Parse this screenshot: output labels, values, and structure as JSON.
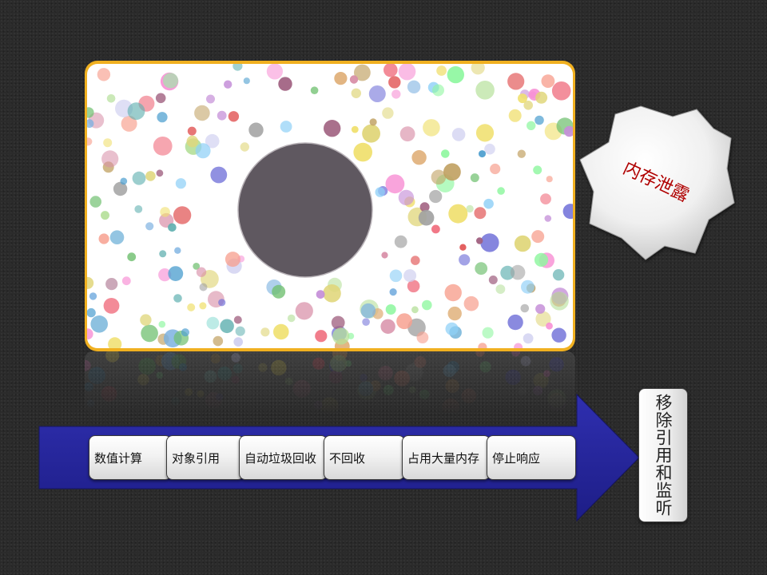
{
  "slide": {
    "badge_label": "内存泄露",
    "steps": [
      "数值计算",
      "对象引用",
      "自动垃圾回收",
      "不回收",
      "占用大量内存",
      "停止响应"
    ],
    "end_label": "移除引用和监听",
    "colors": {
      "frame": "#f0b020",
      "arrow": "#2a2a9a",
      "big_circle": "#5f5860",
      "badge_text": "#b00000"
    }
  }
}
